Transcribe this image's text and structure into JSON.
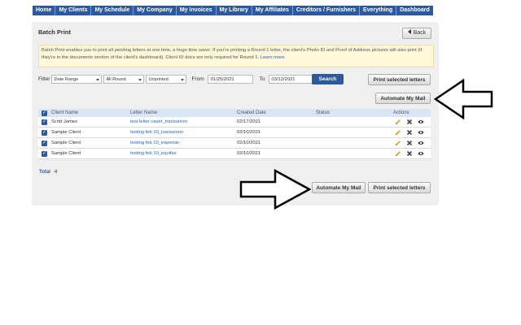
{
  "nav": [
    "Home",
    "My Clients",
    "My Schedule",
    "My Company",
    "My Invoices",
    "My Library",
    "My Affiliates",
    "Creditors / Furnishers",
    "Everything",
    "Dashboard"
  ],
  "panel": {
    "title": "Batch Print",
    "back_label": "Back",
    "notice_text": "Batch Print enables you to print all pending letters at one time, a huge time saver. If you're printing a Round 1 letter, the client's Photo ID and Proof of Address pictures will also print (if they're in the documents section of the client's dashboard). Client ID docs are only required for Round 1.",
    "notice_link": "Learn more."
  },
  "filter": {
    "label": "Filter",
    "date_range": "Date Range",
    "round": "All Round",
    "status": "Unprinted",
    "from_label": "From",
    "from_value": "01/25/2021",
    "to_label": "To",
    "to_value": "03/12/2021",
    "search_label": "Search"
  },
  "buttons": {
    "print_selected": "Print selected letters",
    "automate": "Automate My Mail"
  },
  "table": {
    "headers": {
      "client": "Client Name",
      "letter": "Letter Name",
      "created": "Created Date",
      "status": "Status",
      "actions": "Actions"
    },
    "rows": [
      {
        "client": "Scott James",
        "letter": "test letter caver_transunion",
        "created": "02/17/2021",
        "status": ""
      },
      {
        "client": "Sample Client",
        "letter": "testing feb 10_transunion",
        "created": "02/10/2021",
        "status": ""
      },
      {
        "client": "Sample Client",
        "letter": "testing feb 10_experian",
        "created": "02/10/2021",
        "status": ""
      },
      {
        "client": "Sample Client",
        "letter": "testing feb 10_equifax",
        "created": "02/10/2021",
        "status": ""
      }
    ]
  },
  "total": {
    "label": "Total",
    "value": "4"
  },
  "colors": {
    "nav": "#2c5aa0",
    "accent": "#2a62b3",
    "header_bg": "#d9e4f5",
    "notice_bg": "#fcf8d9"
  }
}
